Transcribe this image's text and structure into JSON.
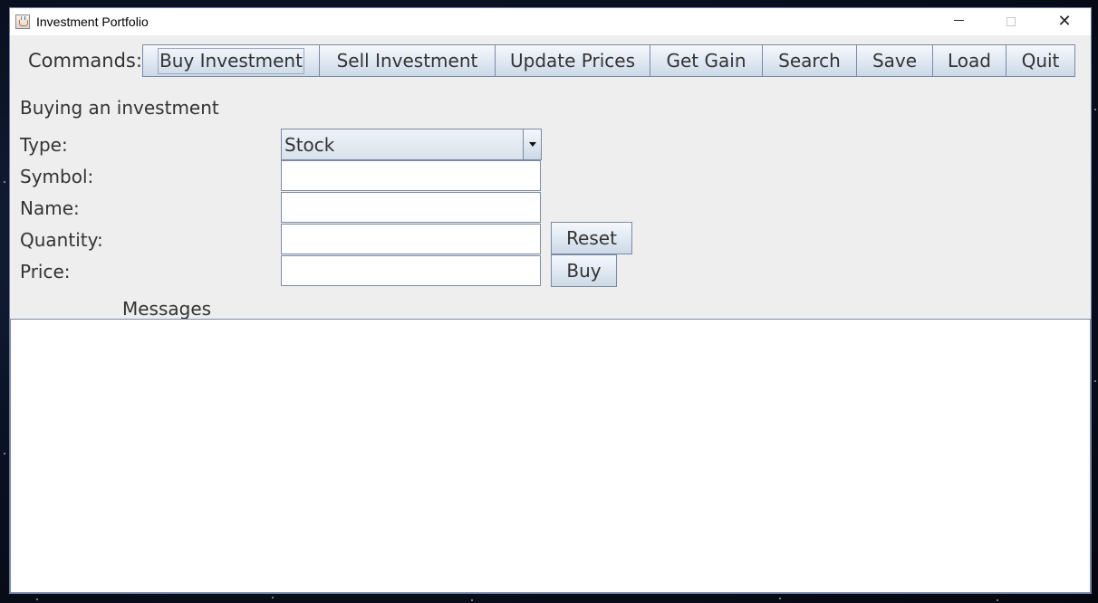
{
  "window": {
    "title": "Investment Portfolio"
  },
  "commands": {
    "label": "Commands:",
    "buttons": [
      {
        "label": "Buy Investment"
      },
      {
        "label": "Sell Investment"
      },
      {
        "label": "Update Prices"
      },
      {
        "label": "Get Gain"
      },
      {
        "label": "Search"
      },
      {
        "label": "Save"
      },
      {
        "label": "Load"
      },
      {
        "label": "Quit"
      }
    ]
  },
  "form": {
    "section_title": "Buying an investment",
    "type_label": "Type:",
    "type_value": "Stock",
    "symbol_label": "Symbol:",
    "symbol_value": "",
    "name_label": "Name:",
    "name_value": "",
    "quantity_label": "Quantity:",
    "quantity_value": "",
    "price_label": "Price:",
    "price_value": "",
    "reset_label": "Reset",
    "buy_label": "Buy"
  },
  "messages": {
    "label": "Messages",
    "content": ""
  },
  "icons": {
    "app": "java-coffee-cup-icon",
    "minimize": "minimize-icon",
    "maximize": "maximize-icon",
    "close": "close-icon",
    "dropdown": "chevron-down-icon"
  }
}
